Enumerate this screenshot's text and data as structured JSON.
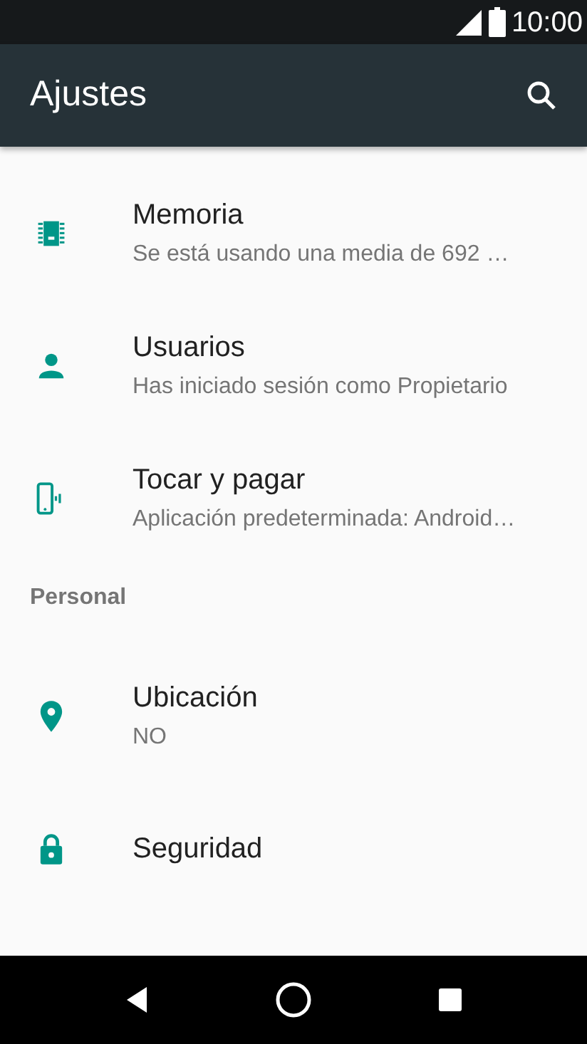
{
  "status_bar": {
    "time": "10:00"
  },
  "app_bar": {
    "title": "Ajustes"
  },
  "sections": [
    {
      "items": [
        {
          "title": "Memoria",
          "subtitle": "Se está usando una media de 692 …"
        },
        {
          "title": "Usuarios",
          "subtitle": "Has iniciado sesión como Propietario"
        },
        {
          "title": "Tocar y pagar",
          "subtitle": "Aplicación predeterminada: Android…"
        }
      ]
    },
    {
      "header": "Personal",
      "items": [
        {
          "title": "Ubicación",
          "subtitle": "NO"
        },
        {
          "title": "Seguridad"
        }
      ]
    }
  ]
}
